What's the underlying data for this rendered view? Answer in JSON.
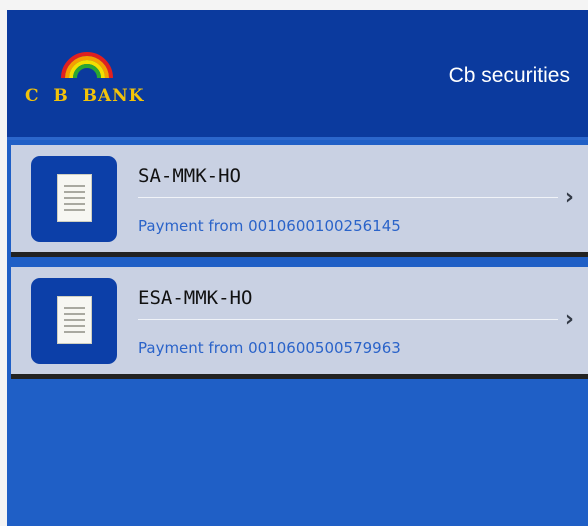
{
  "header": {
    "logo_text": "C  B  BANK",
    "title": "Cb securities"
  },
  "list": {
    "items": [
      {
        "title": "SA-MMK-HO",
        "subtitle": "Payment from 0010600100256145",
        "icon": "document-icon"
      },
      {
        "title": "ESA-MMK-HO",
        "subtitle": "Payment from 0010600500579963",
        "icon": "document-icon"
      }
    ]
  },
  "colors": {
    "header_bg": "#0b3a9e",
    "body_bg": "#1f5fc6",
    "item_bg": "#c9d1e3",
    "logo_text": "#f2c20a",
    "subtitle": "#2a63c9"
  }
}
